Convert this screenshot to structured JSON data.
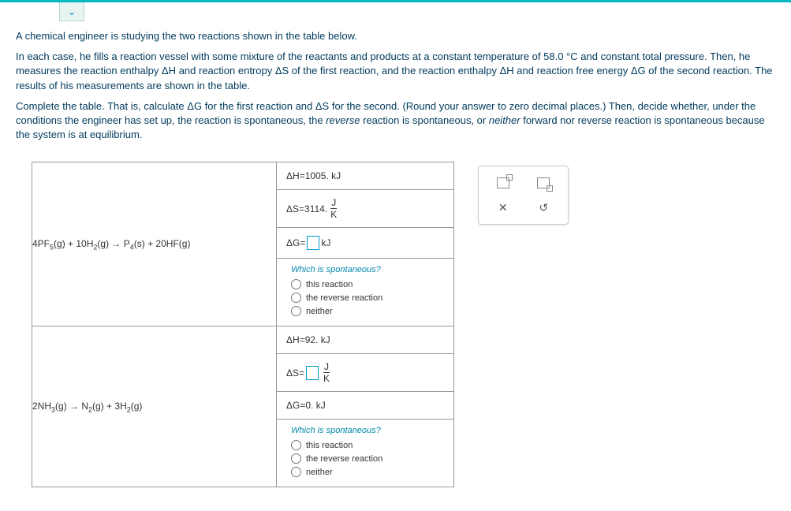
{
  "problem": {
    "p1": "A chemical engineer is studying the two reactions shown in the table below.",
    "p2_a": "In each case, he fills a reaction vessel with some mixture of the reactants and products at a constant temperature of ",
    "p2_temp": "58.0 °C",
    "p2_b": " and constant total pressure. Then, he measures the reaction enthalpy ",
    "p2_c": " and reaction entropy ",
    "p2_d": " of the first reaction, and the reaction enthalpy ",
    "p2_e": " and reaction free energy ",
    "p2_f": " of the second reaction. The results of his measurements are shown in the table.",
    "p3_a": "Complete the table. That is, calculate ",
    "p3_b": " for the first reaction and ",
    "p3_c": " for the second. (Round your answer to zero decimal places.) Then, decide whether, under the conditions the engineer has set up, the reaction is spontaneous, the ",
    "p3_rev": "reverse",
    "p3_d": " reaction is spontaneous, or ",
    "p3_nei": "neither",
    "p3_e": " forward nor reverse reaction is spontaneous because the system is at equilibrium."
  },
  "symbols": {
    "dH": "ΔH",
    "dS": "ΔS",
    "dG": "ΔG",
    "eq": " = ",
    "J": "J",
    "K": "K",
    "kJ": "kJ"
  },
  "reactions": [
    {
      "formula_parts": {
        "a": "4PF",
        "a_sub": "5",
        "b": "(g) + 10H",
        "b_sub": "2",
        "c": "(g) → P",
        "c_sub": "4",
        "d": "(s) + 20HF(g)"
      },
      "dH_val": "1005. kJ",
      "dS_val": "3114.",
      "dG_input": true,
      "dG_val": "",
      "dS_input": false
    },
    {
      "formula_parts": {
        "a": "2NH",
        "a_sub": "3",
        "b": "(g) → N",
        "b_sub": "2",
        "c": "(g) + 3H",
        "c_sub": "2",
        "d": "(g)"
      },
      "dH_val": "92. kJ",
      "dS_val": "",
      "dS_input": true,
      "dG_val": "0. kJ",
      "dG_input": false
    }
  ],
  "spontaneous": {
    "title": "Which is spontaneous?",
    "opt1": "this reaction",
    "opt2": "the reverse reaction",
    "opt3": "neither"
  },
  "toolbox": {
    "close": "✕",
    "reset": "↺"
  }
}
